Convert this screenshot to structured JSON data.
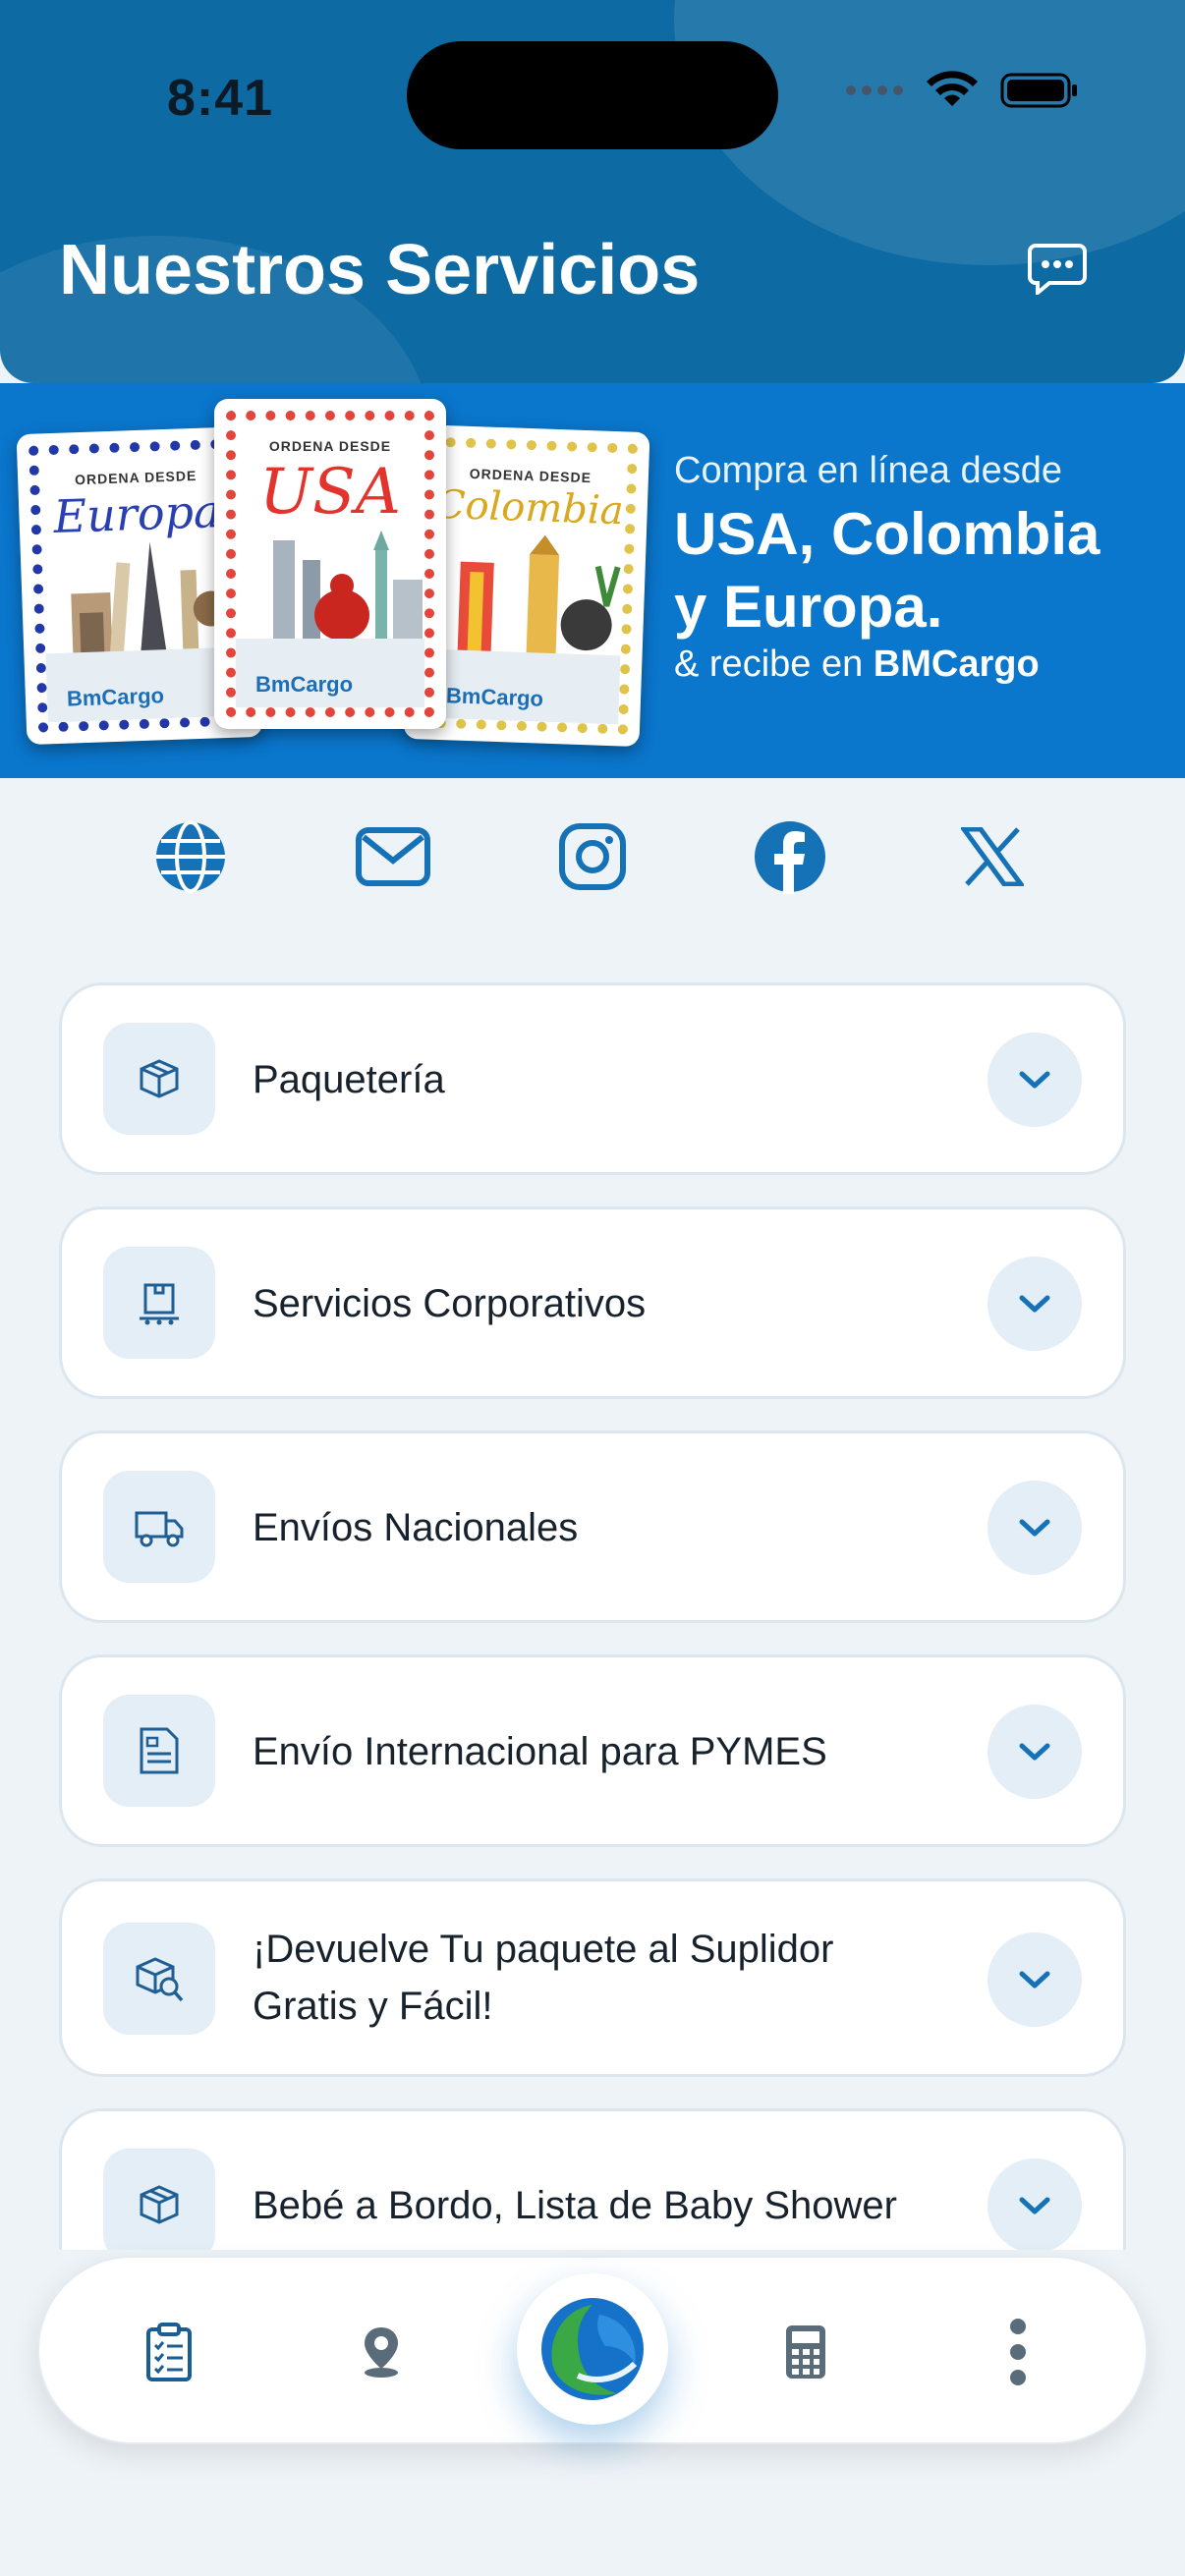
{
  "status_bar": {
    "time": "8:41"
  },
  "header": {
    "title": "Nuestros Servicios"
  },
  "banner": {
    "ordena_label": "ORDENA DESDE",
    "stamps": [
      "Europa",
      "USA",
      "Colombia"
    ],
    "stamp_logo": "BmCargo",
    "line1": "Compra en línea desde",
    "line2": "USA, Colombia",
    "line3": "y Europa.",
    "line4_prefix": "& recibe en ",
    "line4_brand": "BMCargo"
  },
  "social": [
    "globe-icon",
    "mail-icon",
    "instagram-icon",
    "facebook-icon",
    "x-icon"
  ],
  "services": [
    {
      "label": "Paquetería",
      "icon": "package-icon"
    },
    {
      "label": "Servicios Corporativos",
      "icon": "corporate-box-icon"
    },
    {
      "label": "Envíos Nacionales",
      "icon": "truck-icon"
    },
    {
      "label": "Envío Internacional para PYMES",
      "icon": "document-icon"
    },
    {
      "label": "¡Devuelve Tu paquete al Suplidor Gratis y Fácil!",
      "icon": "package-search-icon"
    },
    {
      "label": "Bebé a Bordo, Lista de Baby Shower",
      "icon": "package-icon"
    }
  ],
  "colors": {
    "primary": "#0d6aa2",
    "accent": "#1572b6",
    "banner": "#0a76cc",
    "background": "#eef3f7"
  },
  "bottom_nav": [
    "clipboard-icon",
    "location-icon",
    "globe-logo-icon",
    "calculator-icon",
    "more-icon"
  ]
}
